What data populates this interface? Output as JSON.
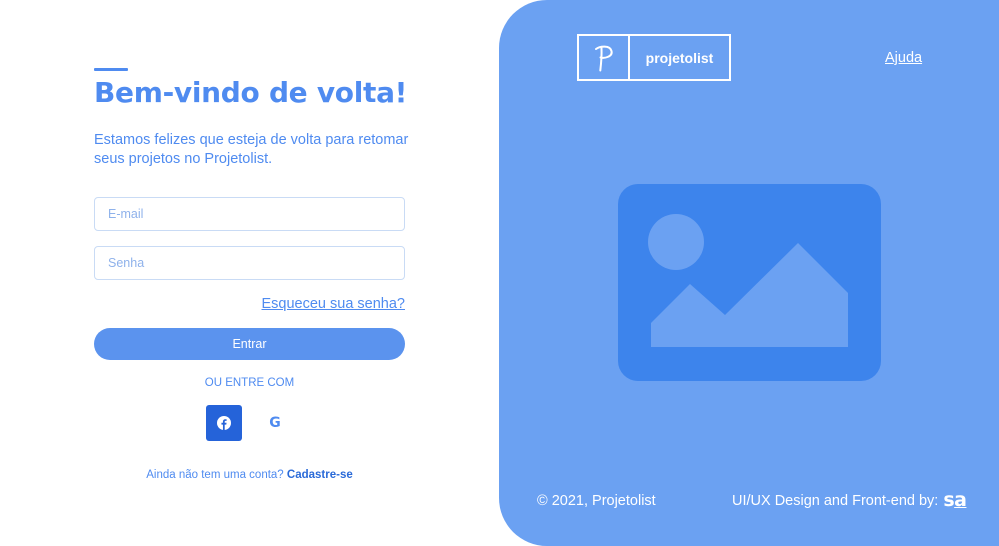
{
  "login": {
    "title": "Bem-vindo de volta!",
    "subtitle": "Estamos felizes que esteja de volta para retomar seus projetos no Projetolist.",
    "email_placeholder": "E-mail",
    "password_placeholder": "Senha",
    "forgot_label": "Esqueceu sua senha?",
    "submit_label": "Entrar",
    "or_label": "OU ENTRE COM",
    "google_label": "G",
    "signup_prompt": "Ainda não tem uma conta?",
    "signup_link": "Cadastre-se"
  },
  "panel": {
    "brand_mark": "P",
    "brand_name": "projetolist",
    "help_label": "Ajuda",
    "copyright": "© 2021, Projetolist",
    "credit": "UI/UX Design and Front-end by:",
    "credit_logo_a": "s",
    "credit_logo_b": "a"
  },
  "colors": {
    "accent": "#4f8bf0",
    "button": "#5b93ee",
    "facebook": "#2563d9",
    "panel_bg": "#6ba1f2",
    "image_placeholder": "#3d84ec"
  },
  "icons": [
    "facebook-icon",
    "google-icon",
    "image-placeholder-icon"
  ]
}
